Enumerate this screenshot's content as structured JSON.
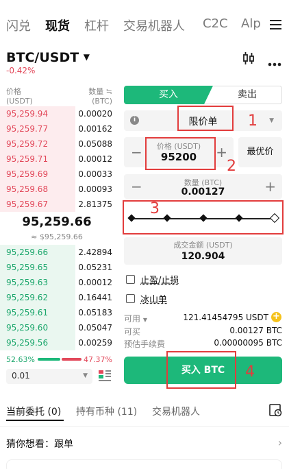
{
  "nav": {
    "tabs": [
      {
        "label": "闪兑"
      },
      {
        "label": "现货"
      },
      {
        "label": "杠杆"
      },
      {
        "label": "交易机器人"
      },
      {
        "label": "C2C"
      },
      {
        "label": "Alp"
      }
    ]
  },
  "market": {
    "pair": "BTC/USDT",
    "change": "-0.42%"
  },
  "orderbook": {
    "price_header": "价格",
    "price_unit": "(USDT)",
    "qty_header": "数量 ≒",
    "qty_unit": "(BTC)",
    "asks": [
      {
        "price": "95,259.94",
        "qty": "0.00020"
      },
      {
        "price": "95,259.77",
        "qty": "0.00162"
      },
      {
        "price": "95,259.72",
        "qty": "0.05088"
      },
      {
        "price": "95,259.71",
        "qty": "0.00012"
      },
      {
        "price": "95,259.69",
        "qty": "0.00033"
      },
      {
        "price": "95,259.68",
        "qty": "0.00093"
      },
      {
        "price": "95,259.67",
        "qty": "2.81375"
      }
    ],
    "last_price": "95,259.66",
    "last_price_usd": "≈ $95,259.66",
    "bids": [
      {
        "price": "95,259.66",
        "qty": "2.42894"
      },
      {
        "price": "95,259.65",
        "qty": "0.05231"
      },
      {
        "price": "95,259.63",
        "qty": "0.00012"
      },
      {
        "price": "95,259.62",
        "qty": "0.16441"
      },
      {
        "price": "95,259.61",
        "qty": "0.05183"
      },
      {
        "price": "95,259.60",
        "qty": "0.05047"
      },
      {
        "price": "95,259.56",
        "qty": "0.00259"
      }
    ],
    "buy_ratio": "52.63%",
    "sell_ratio": "47.37%",
    "buy_fraction": 0.5263,
    "precision": "0.01"
  },
  "order": {
    "buy_tab": "买入",
    "sell_tab": "卖出",
    "order_type": "限价单",
    "price_label": "价格 (USDT)",
    "price_value": "95200",
    "best_price": "最优价",
    "qty_label": "数量 (BTC)",
    "qty_value": "0.00127",
    "total_label": "成交金额 (USDT)",
    "total_value": "120.904",
    "tpsl": "止盈/止损",
    "iceberg": "冰山单",
    "available_label": "可用",
    "available_value": "121.41454795 USDT",
    "can_buy_label": "可买",
    "can_buy_value": "0.00127 BTC",
    "fee_label": "预估手续费",
    "fee_value": "0.00000095 BTC",
    "submit": "买入 BTC"
  },
  "annotations": [
    "1",
    "2",
    "3",
    "4"
  ],
  "bottom": {
    "tabs": [
      {
        "label": "当前委托 (0)"
      },
      {
        "label": "持有币种 (11)"
      },
      {
        "label": "交易机器人"
      }
    ],
    "guess": "猜你想看：跟单"
  },
  "colors": {
    "green": "#1db87a",
    "red": "#e2485a",
    "annotation": "#e23c3c"
  }
}
